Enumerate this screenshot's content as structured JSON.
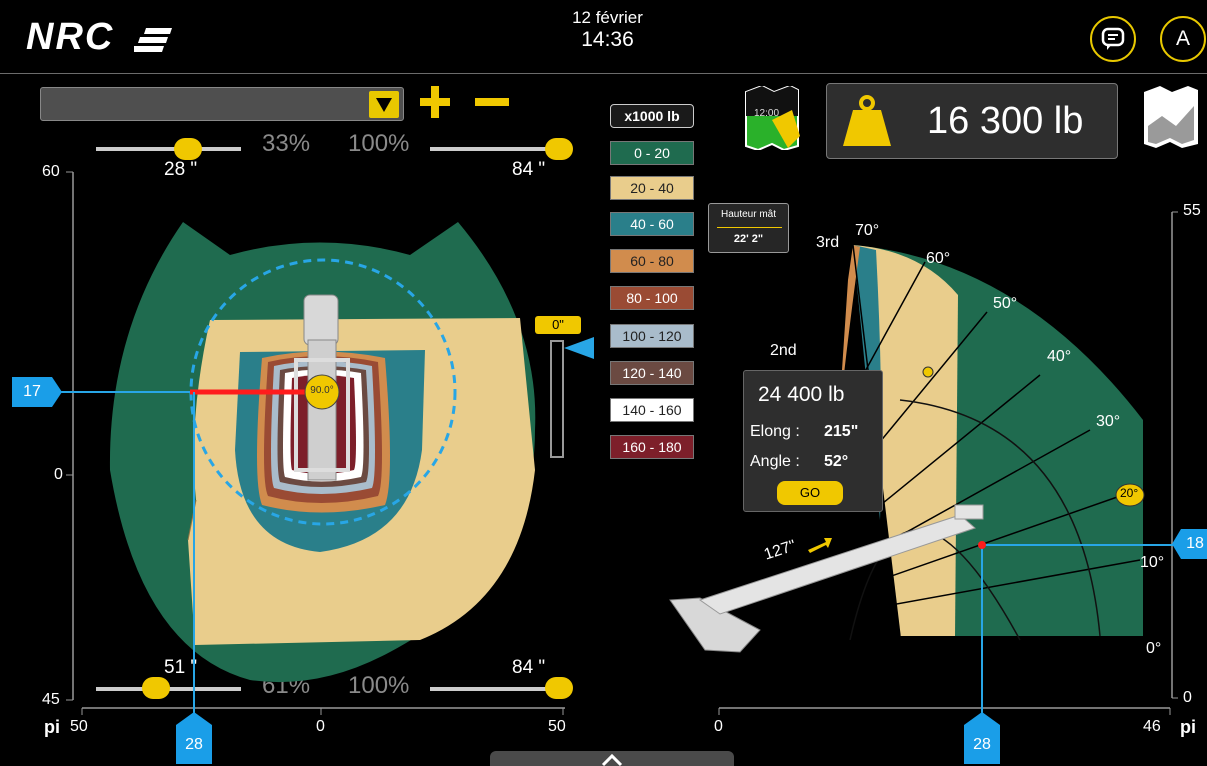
{
  "header": {
    "logo": "NRC",
    "date": "12 février",
    "time": "14:36",
    "user_initial": "A",
    "accent": "#f0c800"
  },
  "left_panel": {
    "plus_label": "+",
    "minus_label": "−",
    "top_slider": {
      "left_value": "28 \"",
      "left_pct": "33%",
      "right_pct": "100%",
      "right_value": "84 \""
    },
    "bottom_slider": {
      "left_value": "51 \"",
      "left_pct": "61%",
      "right_pct": "100%",
      "right_value": "84 \""
    },
    "y_axis": {
      "top": "60",
      "mid": "0",
      "bottom": "45"
    },
    "x_axis": {
      "unit": "pi",
      "left": "50",
      "mid": "0",
      "right": "50"
    },
    "marker_y": "17",
    "marker_x": "28",
    "swing_angle": "90.0°",
    "vertical_indicator": "0\""
  },
  "legend": {
    "title": "x1000 lb",
    "items": [
      {
        "label": "0 - 20",
        "color": "#1f6b4f",
        "text": "#fff"
      },
      {
        "label": "20 - 40",
        "color": "#e9cd8c",
        "text": "#222"
      },
      {
        "label": "40 - 60",
        "color": "#2a7f8a",
        "text": "#fff"
      },
      {
        "label": "60 - 80",
        "color": "#d18c4d",
        "text": "#222"
      },
      {
        "label": "80 - 100",
        "color": "#9a4b34",
        "text": "#fff"
      },
      {
        "label": "100 - 120",
        "color": "#a9bccb",
        "text": "#222"
      },
      {
        "label": "120 - 140",
        "color": "#6b4a42",
        "text": "#fff"
      },
      {
        "label": "140 - 160",
        "color": "#ffffff",
        "text": "#222"
      },
      {
        "label": "160 - 180",
        "color": "#7d1f2a",
        "text": "#fff"
      }
    ]
  },
  "load": {
    "value": "16 300 lb"
  },
  "map_icon_label": "12:00",
  "mast": {
    "title": "Hauteur mât",
    "value": "22' 2\""
  },
  "right_panel": {
    "angles": [
      "70°",
      "60°",
      "50°",
      "40°",
      "30°",
      "20°",
      "10°",
      "0°"
    ],
    "sections": [
      "3rd",
      "2nd"
    ],
    "boom_extension": "127\"",
    "y_axis": {
      "top": "55",
      "bottom": "0"
    },
    "x_axis": {
      "left": "0",
      "right": "46",
      "unit": "pi"
    },
    "marker_y": "18",
    "marker_x": "28"
  },
  "popup": {
    "capacity": "24 400 lb",
    "elong_label": "Elong :",
    "elong_value": "215\"",
    "angle_label": "Angle :",
    "angle_value": "52°",
    "go_label": "GO"
  }
}
